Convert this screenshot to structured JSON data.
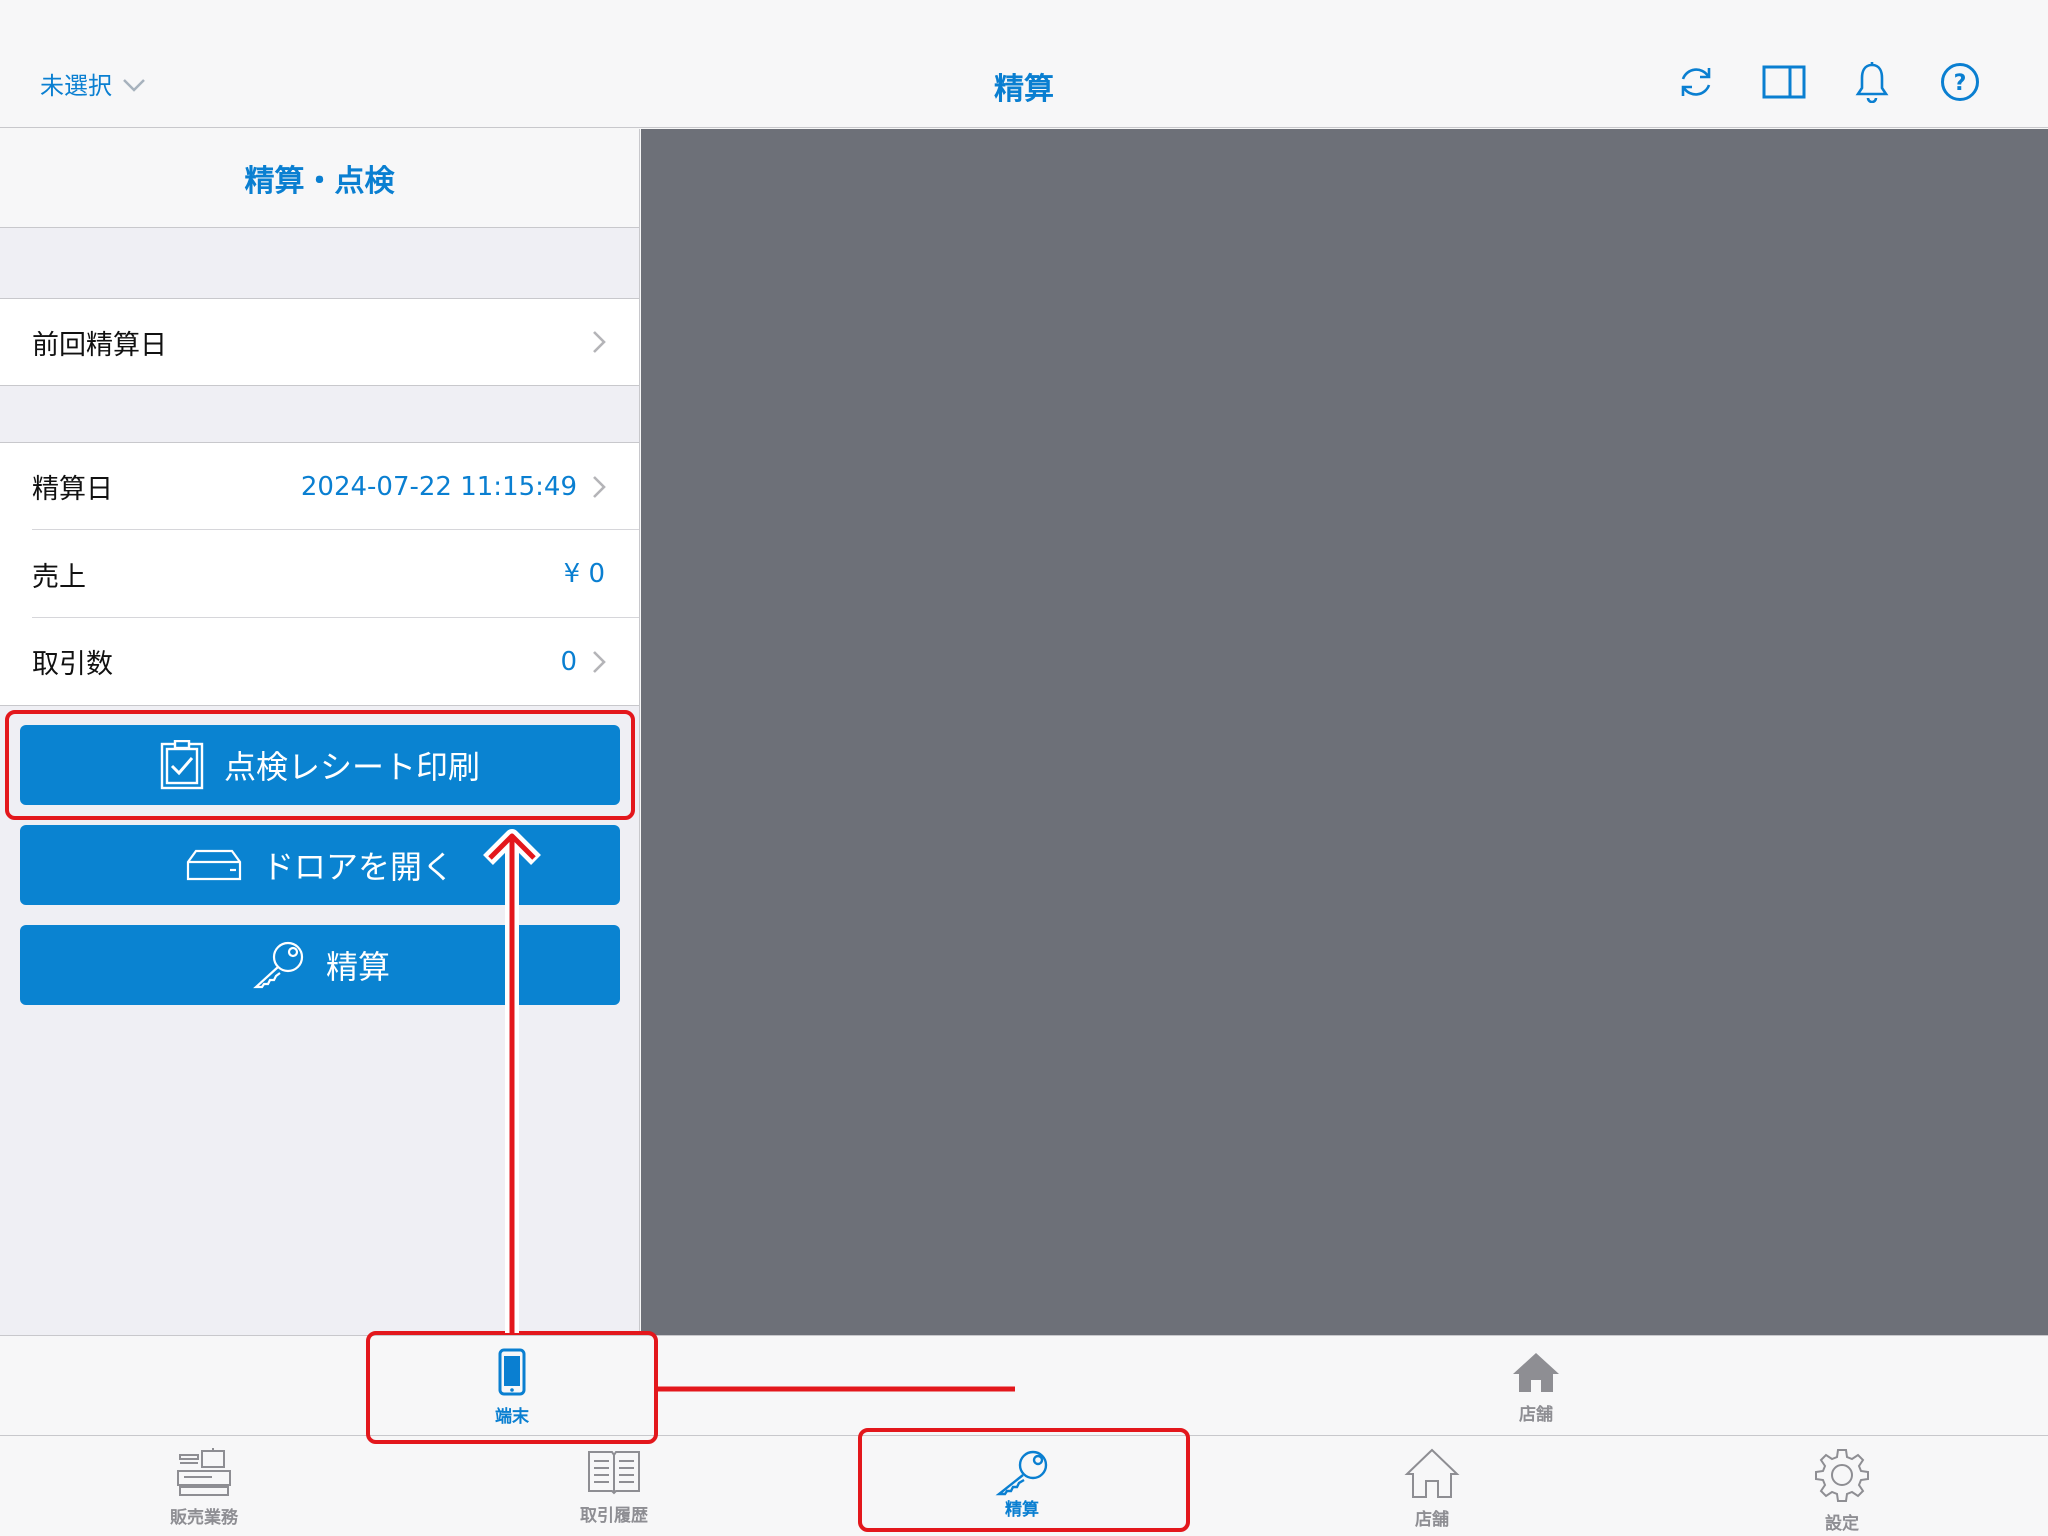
{
  "header": {
    "store_select": "未選択",
    "title": "精算"
  },
  "panel": {
    "title": "精算・点検",
    "last_settlement": {
      "label": "前回精算日"
    },
    "rows": [
      {
        "label": "精算日",
        "value": "2024-07-22 11:15:49"
      },
      {
        "label": "売上",
        "value": "¥ 0"
      },
      {
        "label": "取引数",
        "value": "0"
      }
    ],
    "buttons": {
      "print_receipt": "点検レシート印刷",
      "open_drawer": "ドロアを開く",
      "settle": "精算"
    }
  },
  "subtabs": {
    "terminal": "端末",
    "store": "店舗"
  },
  "tabs": {
    "sales": "販売業務",
    "history": "取引履歴",
    "settlement": "精算",
    "store": "店舗",
    "settings": "設定"
  },
  "colors": {
    "accent": "#0a7fd1",
    "button": "#0a83d1",
    "highlight": "#e3171c",
    "detail_pane": "#6d7078"
  },
  "icons": [
    "chevron-down-icon",
    "refresh-icon",
    "split-view-icon",
    "bell-icon",
    "help-icon",
    "chevron-right-icon",
    "clipboard-check-icon",
    "drawer-icon",
    "key-icon",
    "smartphone-icon",
    "home-icon",
    "cash-register-icon",
    "book-icon",
    "gear-icon"
  ]
}
